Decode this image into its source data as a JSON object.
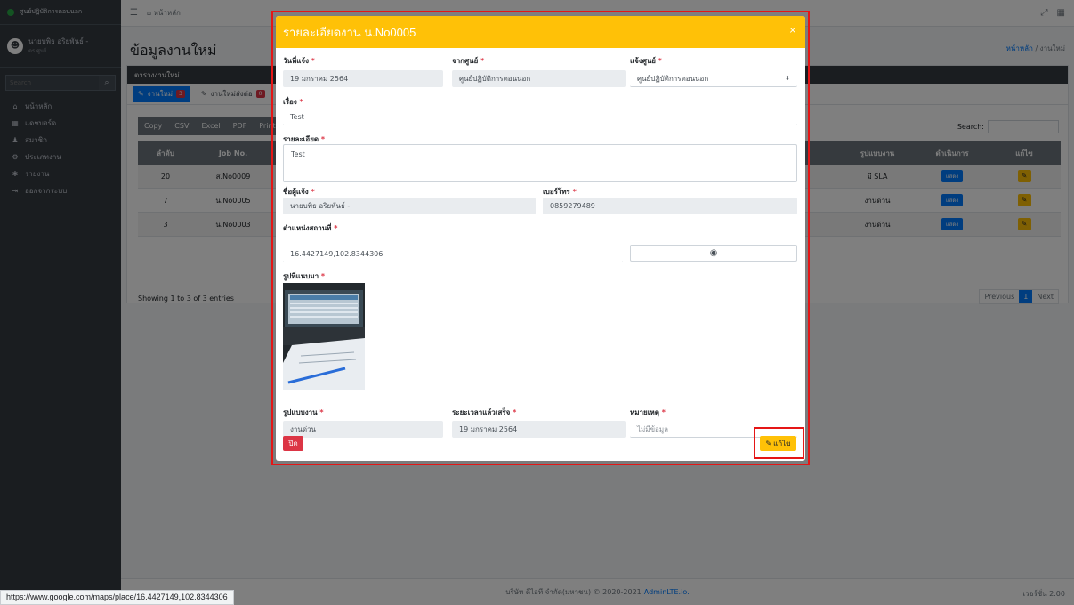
{
  "colors": {
    "accent": "#ffc107",
    "primary": "#007bff",
    "danger": "#dc3545",
    "sidebar": "#343a40",
    "highlight": "#e51616"
  },
  "brand": {
    "name": "ศูนย์ปฏิบัติการตอนนอก"
  },
  "user": {
    "name": "นายบพิธ อริยพันธ์ -",
    "sub": "ตร.ศูนย์"
  },
  "sidebar": {
    "search_placeholder": "Search",
    "items": [
      {
        "icon": "home-icon",
        "label": "หน้าหลัก"
      },
      {
        "icon": "dashboard-icon",
        "label": "แดชบอร์ด"
      },
      {
        "icon": "users-icon",
        "label": "สมาชิก"
      },
      {
        "icon": "cogs-icon",
        "label": "ประเภทงาน"
      },
      {
        "icon": "gear-icon",
        "label": "รายงาน"
      },
      {
        "icon": "logout-icon",
        "label": "ออกจากระบบ"
      }
    ]
  },
  "topbar": {
    "home": "หน้าหลัก"
  },
  "page": {
    "title": "ข้อมูลงานใหม่",
    "breadcrumb_home": "หน้าหลัก",
    "breadcrumb_current": "/ งานใหม่"
  },
  "card": {
    "header": "ตารางงานใหม่"
  },
  "tabs": [
    {
      "label": "งานใหม่",
      "badge": "3"
    },
    {
      "label": "งานใหม่ส่งต่อ",
      "badge": "0"
    }
  ],
  "dt_buttons": [
    "Copy",
    "CSV",
    "Excel",
    "PDF",
    "Print"
  ],
  "search_label": "Search:",
  "table": {
    "headers": {
      "no": "ลำดับ",
      "job": "Job No.",
      "type": "รูปแบบงาน",
      "action": "ดำเนินการ",
      "edit": "แก้ไข"
    },
    "rows": [
      {
        "no": "20",
        "job": "ส.No0009",
        "type": "มี SLA",
        "action": "แสดง"
      },
      {
        "no": "7",
        "job": "น.No0005",
        "type": "งานด่วน",
        "action": "แสดง"
      },
      {
        "no": "3",
        "job": "น.No0003",
        "type": "งานด่วน",
        "action": "แสดง"
      }
    ]
  },
  "showing": "Showing 1 to 3 of 3 entries",
  "pagination": {
    "prev": "Previous",
    "current": "1",
    "next": "Next"
  },
  "footer": {
    "text": "บริษัท ดีไอที จำกัด(มหาชน) © 2020-2021",
    "link": "AdminLTE.io.",
    "version": "เวอร์ชั่น 2.00"
  },
  "status_url": "https://www.google.com/maps/place/16.4427149,102.8344306",
  "modal": {
    "title": "รายละเอียดงาน น.No0005",
    "close": "×",
    "required_mark": "*",
    "fields": {
      "date_label": "วันที่แจ้ง",
      "date_value": "19 มกราคม 2564",
      "from_label": "จากศูนย์",
      "from_value": "ศูนย์ปฏิบัติการตอนนอก",
      "to_label": "แจ้งศูนย์",
      "to_value": "ศูนย์ปฏิบัติการตอนนอก",
      "subject_label": "เรื่อง",
      "subject_value": "Test",
      "detail_label": "รายละเอียด",
      "detail_value": "Test",
      "reporter_label": "ชื่อผู้แจ้ง",
      "reporter_value": "นายบพิธ อริยพันธ์ -",
      "phone_label": "เบอร์โทร",
      "phone_value": "0859279489",
      "location_label": "ตำแหน่งสถานที่",
      "location_value": "16.4427149,102.8344306",
      "photo_label": "รูปที่แนบมา",
      "type_label": "รูปแบบงาน",
      "type_value": "งานด่วน",
      "duration_label": "ระยะเวลาแล้วเสร็จ",
      "duration_value": "19 มกราคม 2564",
      "note_label": "หมายเหตุ",
      "note_placeholder": "ไม่มีข้อมูล"
    },
    "close_button": "ปิด",
    "edit_button": "แก้ไข"
  }
}
